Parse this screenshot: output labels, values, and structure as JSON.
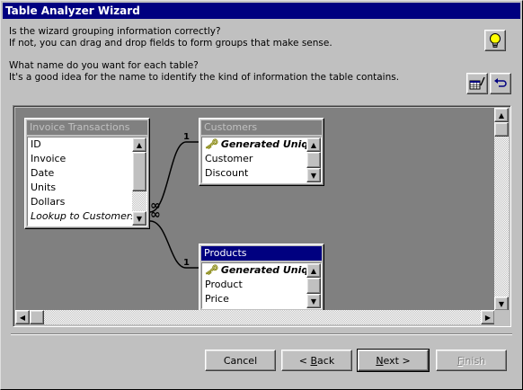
{
  "window": {
    "title": "Table Analyzer Wizard"
  },
  "instructions": {
    "line1": "Is the wizard grouping information correctly?",
    "line2": "If not, you can drag and drop fields to form groups that make sense.",
    "line3": "What name do you want for each table?",
    "line4": "It's a good idea for the name to identify the kind of information the table contains."
  },
  "toolbar": {
    "tips_icon": "lightbulb-icon",
    "rename_icon": "rename-table-icon",
    "undo_icon": "undo-icon"
  },
  "tables": {
    "invoice": {
      "title": "Invoice Transactions",
      "fields": [
        "ID",
        "Invoice",
        "Date",
        "Units",
        "Dollars",
        "Lookup to Customers"
      ]
    },
    "customers": {
      "title": "Customers",
      "fields": [
        "Generated Unique ID",
        "Customer",
        "Discount"
      ]
    },
    "products": {
      "title": "Products",
      "fields": [
        "Generated Unique ID",
        "Product",
        "Price"
      ]
    }
  },
  "relationships": {
    "one_label": "1",
    "many_symbol": "∞"
  },
  "buttons": {
    "cancel": "Cancel",
    "back_prefix": "< ",
    "back_acc": "B",
    "back_rest": "ack",
    "next_acc": "N",
    "next_rest": "ext >",
    "finish_acc": "F",
    "finish_rest": "inish"
  },
  "colors": {
    "titlebar": "#000080",
    "face": "#c0c0c0",
    "canvas": "#808080",
    "active_table_title": "#000080"
  }
}
